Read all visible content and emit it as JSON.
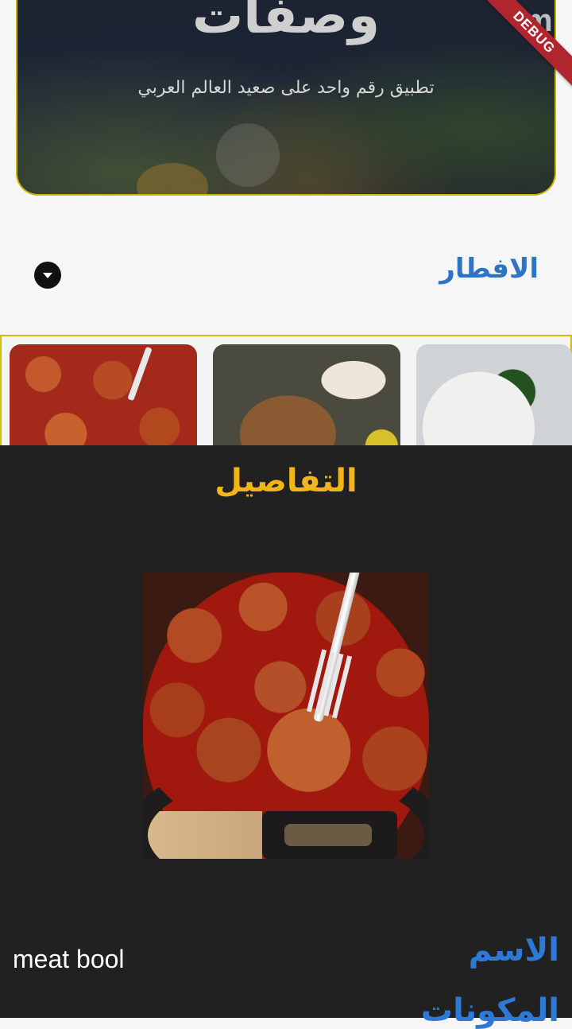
{
  "banner": {
    "title": "وصفات",
    "subtitle": "تطبيق رقم واحد على صعيد العالم العربي",
    "debug_label": "DEBUG",
    "logo_letter": "m"
  },
  "section": {
    "title": "الافطار"
  },
  "cards": [
    {
      "name": "meatball-card"
    },
    {
      "name": "shawarma-card"
    },
    {
      "name": "salad-bowl-card"
    }
  ],
  "details": {
    "title": "التفاصيل",
    "name_label": "الاسم",
    "name_value": "meat bool",
    "next_label": "المكونات"
  },
  "colors": {
    "accent_title": "#f1b51a",
    "label_blue": "#2f79d6",
    "sheet_bg": "#212121",
    "card_border": "#d2bf00"
  }
}
